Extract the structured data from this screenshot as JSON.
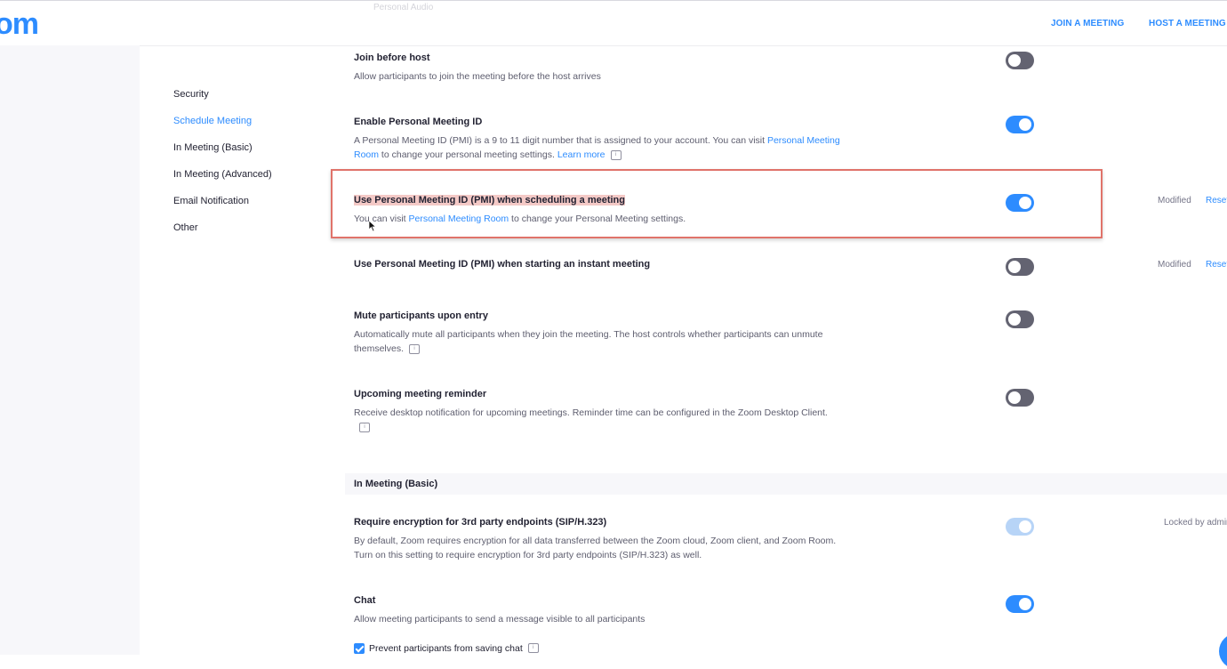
{
  "header": {
    "logo": "om",
    "ghost_text": "Personal Audio",
    "join_meeting": "JOIN A MEETING",
    "host_meeting": "HOST A MEETING"
  },
  "sidebar": {
    "items": [
      {
        "label": "Security",
        "active": false
      },
      {
        "label": "Schedule Meeting",
        "active": true
      },
      {
        "label": "In Meeting (Basic)",
        "active": false
      },
      {
        "label": "In Meeting (Advanced)",
        "active": false
      },
      {
        "label": "Email Notification",
        "active": false
      },
      {
        "label": "Other",
        "active": false
      }
    ]
  },
  "settings": {
    "join_before_host": {
      "title": "Join before host",
      "desc": "Allow participants to join the meeting before the host arrives",
      "enabled": false
    },
    "enable_pmi": {
      "title": "Enable Personal Meeting ID",
      "desc_part1": "A Personal Meeting ID (PMI) is a 9 to 11 digit number that is assigned to your account. You can visit ",
      "desc_link": "Personal Meeting Room",
      "desc_part2": " to change your personal meeting settings. ",
      "learn_more": "Learn more",
      "enabled": true
    },
    "pmi_scheduling": {
      "title": "Use Personal Meeting ID (PMI) when scheduling a meeting",
      "desc_part1": "You can visit ",
      "desc_link": "Personal Meeting Room",
      "desc_part2": " to change your Personal Meeting settings.",
      "enabled": true,
      "status": "Modified",
      "reset": "Reset"
    },
    "pmi_instant": {
      "title": "Use Personal Meeting ID (PMI) when starting an instant meeting",
      "enabled": false,
      "status": "Modified",
      "reset": "Reset"
    },
    "mute_on_entry": {
      "title": "Mute participants upon entry",
      "desc": "Automatically mute all participants when they join the meeting. The host controls whether participants can unmute themselves.",
      "enabled": false
    },
    "upcoming_reminder": {
      "title": "Upcoming meeting reminder",
      "desc": "Receive desktop notification for upcoming meetings. Reminder time can be configured in the Zoom Desktop Client.",
      "enabled": false
    }
  },
  "in_meeting_basic": {
    "header": "In Meeting (Basic)",
    "require_encryption": {
      "title": "Require encryption for 3rd party endpoints (SIP/H.323)",
      "desc": "By default, Zoom requires encryption for all data transferred between the Zoom cloud, Zoom client, and Zoom Room. Turn on this setting to require encryption for 3rd party endpoints (SIP/H.323) as well.",
      "enabled": true,
      "status": "Locked by admin"
    },
    "chat": {
      "title": "Chat",
      "desc": "Allow meeting participants to send a message visible to all participants",
      "enabled": true,
      "prevent_saving_label": "Prevent participants from saving chat",
      "prevent_saving_checked": true
    }
  },
  "icons": {
    "info": "info-icon",
    "cursor": "mouse-pointer-icon",
    "caret": "chevron-down-icon"
  },
  "colors": {
    "brand": "#2d8cff",
    "toggle_off": "#636371",
    "toggle_locked": "#b7d4f7",
    "callout_border": "#e0736a",
    "highlight": "#f4c9c6"
  }
}
